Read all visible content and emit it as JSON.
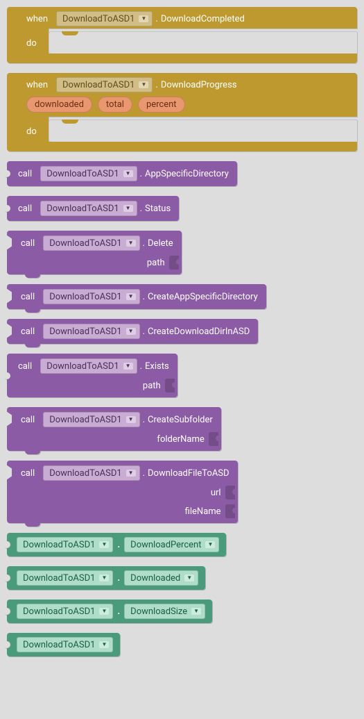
{
  "events": [
    {
      "component": "DownloadToASD1",
      "eventName": "DownloadCompleted",
      "keywordWhen": "when",
      "keywordDo": "do",
      "params": []
    },
    {
      "component": "DownloadToASD1",
      "eventName": "DownloadProgress",
      "keywordWhen": "when",
      "keywordDo": "do",
      "params": [
        "downloaded",
        "total",
        "percent"
      ]
    }
  ],
  "calls": [
    {
      "type": "expr",
      "component": "DownloadToASD1",
      "method": "AppSpecificDirectory",
      "keyword": "call",
      "args": []
    },
    {
      "type": "expr",
      "component": "DownloadToASD1",
      "method": "Status",
      "keyword": "call",
      "args": []
    },
    {
      "type": "stmt",
      "component": "DownloadToASD1",
      "method": "Delete",
      "keyword": "call",
      "args": [
        "path"
      ]
    },
    {
      "type": "stmt",
      "component": "DownloadToASD1",
      "method": "CreateAppSpecificDirectory",
      "keyword": "call",
      "args": []
    },
    {
      "type": "stmt",
      "component": "DownloadToASD1",
      "method": "CreateDownloadDirInASD",
      "keyword": "call",
      "args": []
    },
    {
      "type": "expr",
      "component": "DownloadToASD1",
      "method": "Exists",
      "keyword": "call",
      "args": [
        "path"
      ]
    },
    {
      "type": "stmt",
      "component": "DownloadToASD1",
      "method": "CreateSubfolder",
      "keyword": "call",
      "args": [
        "folderName"
      ]
    },
    {
      "type": "stmt",
      "component": "DownloadToASD1",
      "method": "DownloadFileToASD",
      "keyword": "call",
      "args": [
        "url",
        "fileName"
      ]
    }
  ],
  "properties": [
    {
      "component": "DownloadToASD1",
      "property": "DownloadPercent"
    },
    {
      "component": "DownloadToASD1",
      "property": "Downloaded"
    },
    {
      "component": "DownloadToASD1",
      "property": "DownloadSize"
    },
    {
      "component": "DownloadToASD1",
      "property": null
    }
  ],
  "dot": "."
}
